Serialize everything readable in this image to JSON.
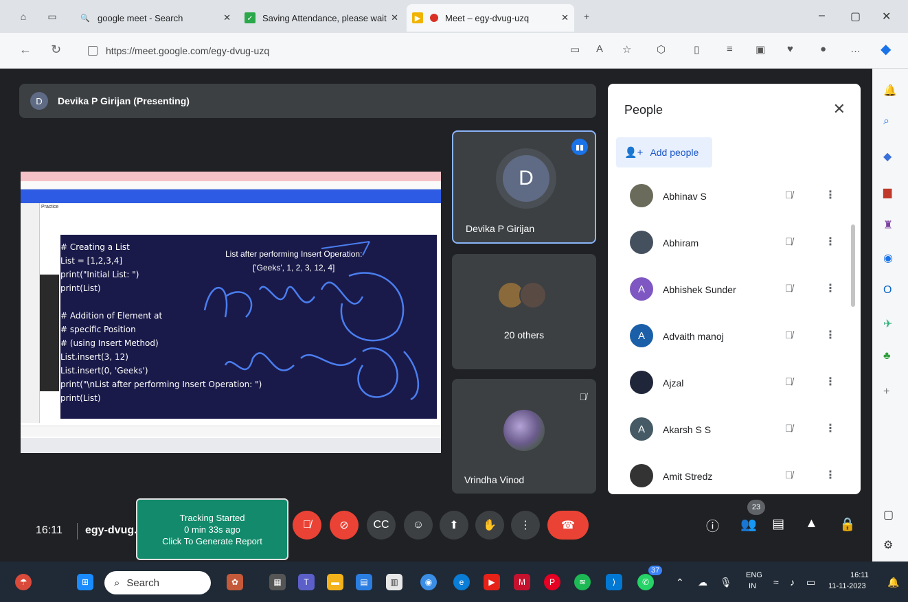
{
  "browser": {
    "tabs": [
      {
        "label": "google meet - Search",
        "active": false
      },
      {
        "label": "Saving Attendance, please wait",
        "active": false
      },
      {
        "label": "Meet – egy-dvug-uzq",
        "active": true
      }
    ],
    "new_tab": "+",
    "url": "https://meet.google.com/egy-dvug-uzq"
  },
  "meet": {
    "presenter_bar": {
      "avatar_letter": "D",
      "title": "Devika P Girijan (Presenting)"
    },
    "shared_screen": {
      "label": "Practice",
      "code_lines": [
        "# Creating a List",
        "List = [1,2,3,4]",
        "print(\"Initial List: \")",
        "print(List)",
        "",
        "# Addition of Element at",
        "# specific Position",
        "# (using Insert Method)",
        "List.insert(3, 12)",
        "List.insert(0, 'Geeks')",
        "print(\"\\nList after performing Insert Operation: \")",
        "print(List)"
      ],
      "output_title": "List after performing Insert Operation:",
      "output_value": "['Geeks', 1, 2, 3, 12, 4]"
    },
    "tiles": {
      "presenter": {
        "name": "Devika P Girijan",
        "avatar_letter": "D"
      },
      "others": {
        "label": "20 others"
      },
      "vrindha": {
        "name": "Vrindha Vinod"
      }
    },
    "people_panel": {
      "title": "People",
      "add_label": "Add people",
      "participants": [
        {
          "name": "Abhinav S",
          "avatar": "",
          "color": "#6b6b5b"
        },
        {
          "name": "Abhiram",
          "avatar": "",
          "color": "#44505e"
        },
        {
          "name": "Abhishek Sunder",
          "avatar": "A",
          "color": "#7e57c2"
        },
        {
          "name": "Advaith manoj",
          "avatar": "A",
          "color": "#1a5fa8"
        },
        {
          "name": "Ajzal",
          "avatar": "",
          "color": "#20263a"
        },
        {
          "name": "Akarsh S S",
          "avatar": "A",
          "color": "#455a64"
        },
        {
          "name": "Amit Stredz",
          "avatar": "",
          "color": "#333333"
        }
      ]
    },
    "controls": {
      "time": "16:11",
      "meeting_code": "egy-dvug...",
      "tracker": [
        "Tracking Started",
        "0 min 33s ago",
        "Click To Generate Report"
      ],
      "participant_count": "23"
    }
  },
  "taskbar": {
    "search_label": "Search",
    "lang": [
      "ENG",
      "IN"
    ],
    "time": "16:11",
    "date": "11-11-2023",
    "notification_badge": "37"
  }
}
